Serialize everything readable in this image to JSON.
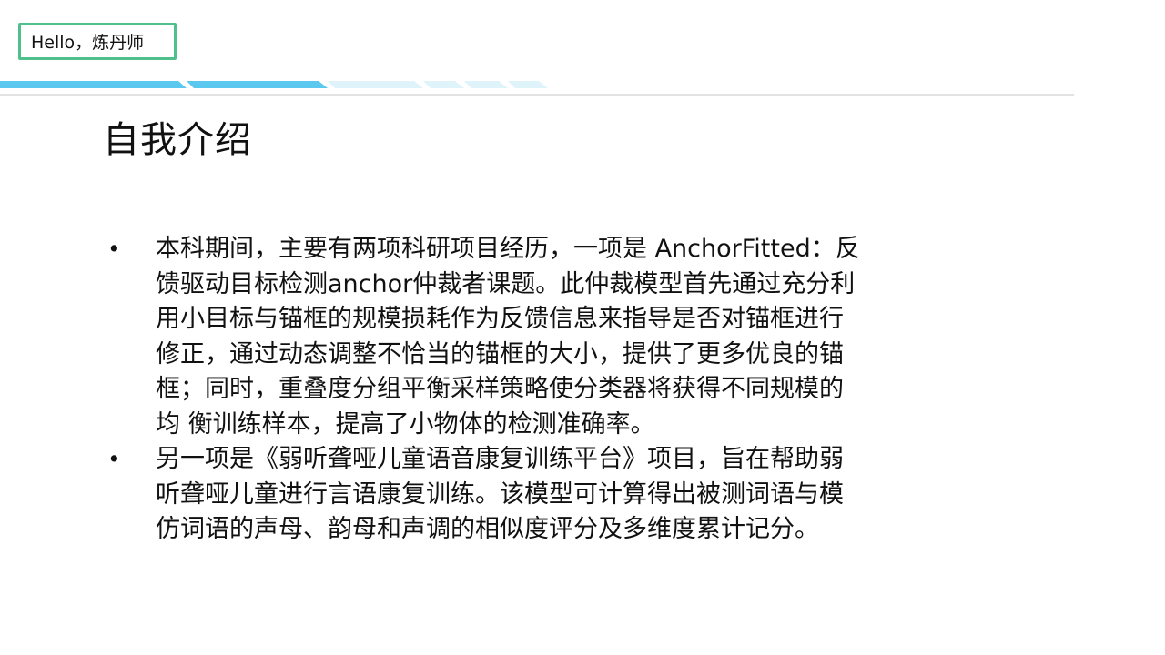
{
  "header": {
    "greeting": "Hello，炼丹师"
  },
  "slide": {
    "title": "自我介绍",
    "bullets": [
      {
        "marker": "•",
        "text": "本科期间，主要有两项科研项目经历，一项是 AnchorFitted：反\n馈驱动目标检测anchor仲裁者课题。此仲裁模型首先通过充分利\n用小目标与锚框的规模损耗作为反馈信息来指导是否对锚框进行\n修正，通过动态调整不恰当的锚框的大小，提供了更多优良的锚\n框；同时，重叠度分组平衡采样策略使分类器将获得不同规模的\n均 衡训练样本，提高了小物体的检测准确率。"
      },
      {
        "marker": "•",
        "text": "另一项是《弱听聋哑儿童语音康复训练平台》项目，旨在帮助弱\n听聋哑儿童进行言语康复训练。该模型可计算得出被测词语与模\n仿词语的声母、韵母和声调的相似度评分及多维度累计记分。"
      }
    ]
  },
  "colors": {
    "greeting_border": "#4fbf8b",
    "band_primary": "#5bc8f0",
    "band_light": "#dff3fb",
    "band_line": "#d8d8d8",
    "text": "#111111"
  }
}
